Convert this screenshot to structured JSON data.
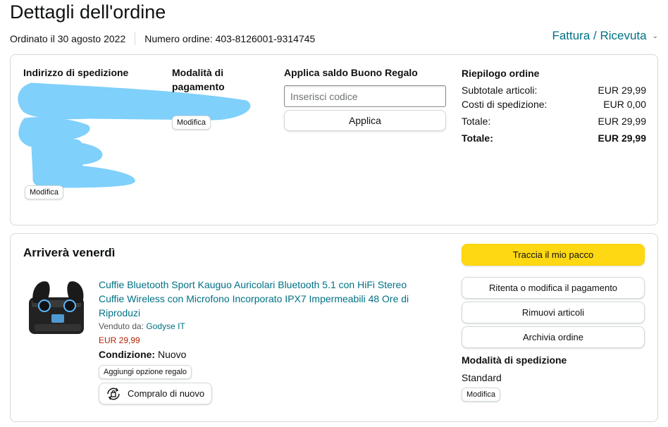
{
  "header": {
    "title": "Dettagli dell'ordine",
    "order_date": "Ordinato il 30 agosto 2022",
    "order_number": "Numero ordine: 403-8126001-9314745",
    "invoice_link": "Fattura / Ricevuta"
  },
  "details": {
    "shipping_address_heading": "Indirizzo di spedizione",
    "shipping_modify": "Modifica",
    "payment_heading_line1": "Modalità di",
    "payment_heading_line2": "pagamento",
    "payment_modify": "Modifica",
    "gift_heading": "Applica saldo Buono Regalo",
    "gift_placeholder": "Inserisci codice",
    "gift_apply": "Applica",
    "summary_heading": "Riepilogo ordine",
    "summary_rows": [
      {
        "label": "Subtotale articoli:",
        "value": "EUR 29,99"
      },
      {
        "label": "Costi di spedizione:",
        "value": "EUR 0,00"
      },
      {
        "label": "Totale:",
        "value": "EUR 29,99"
      },
      {
        "label": "Totale:",
        "value": "EUR 29,99"
      }
    ]
  },
  "shipment": {
    "heading": "Arriverà venerdì",
    "product_title": "Cuffie Bluetooth Sport Kauguo Auricolari Bluetooth 5.1 con HiFi Stereo Cuffie Wireless con Microfono Incorporato IPX7 Impermeabili 48 Ore di Riproduzi",
    "sold_by_label": "Venduto da:",
    "seller": "Godyse IT",
    "price": "EUR 29,99",
    "condition_label": "Condizione:",
    "condition_value": "Nuovo",
    "gift_option": "Aggiungi opzione regalo",
    "buy_again": "Compralo di nuovo",
    "track_button": "Traccia il mio pacco",
    "retry_payment_button": "Ritenta o modifica il pagamento",
    "remove_items_button": "Rimuovi articoli",
    "archive_button": "Archivia ordine",
    "shipping_method_heading": "Modalità di spedizione",
    "shipping_method": "Standard",
    "shipping_modify": "Modifica"
  },
  "colors": {
    "link": "#007185",
    "price": "#b12704",
    "primary_button": "#ffd814",
    "redaction": "#7fd0fb"
  },
  "icons": [
    "chevron-down-icon",
    "buy-again-icon"
  ]
}
